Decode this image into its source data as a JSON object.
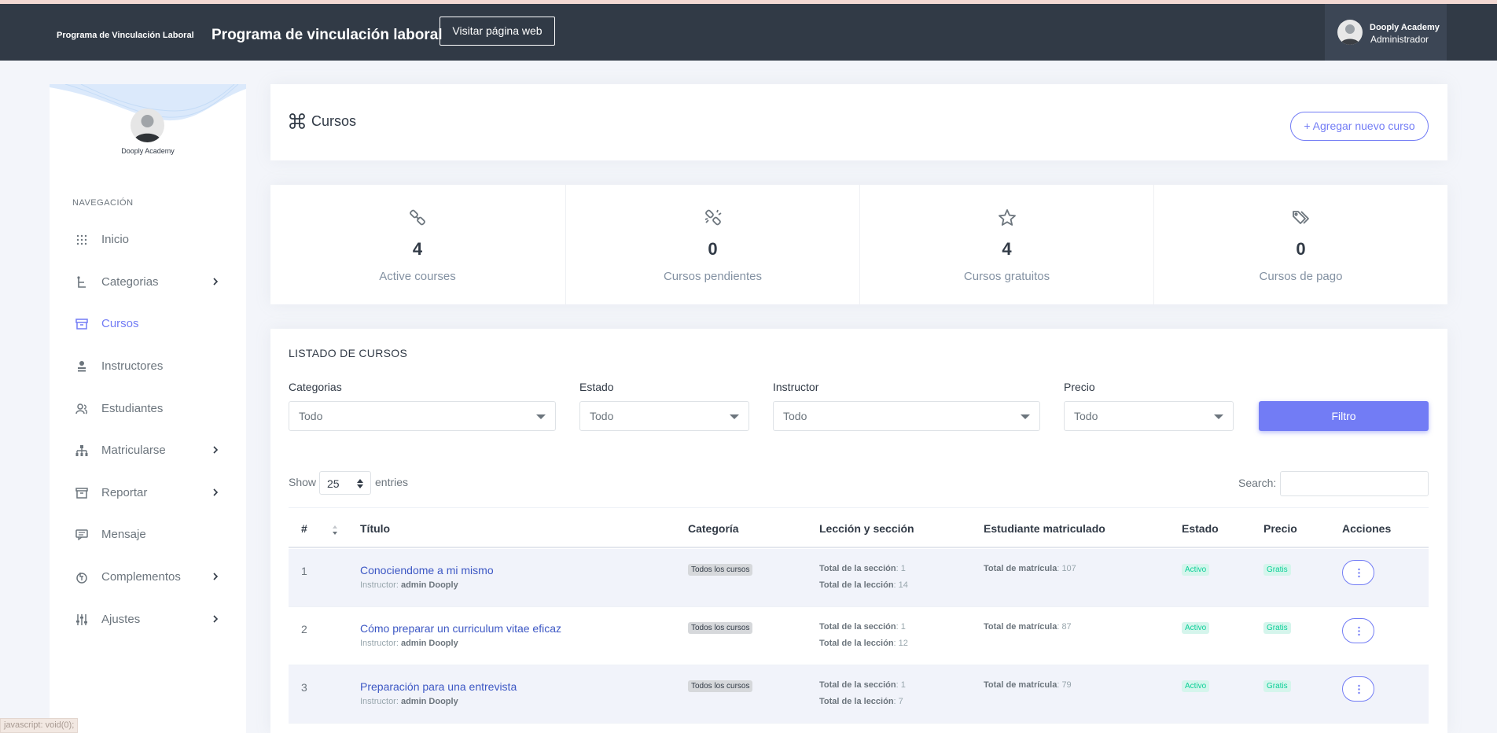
{
  "header": {
    "brand_small": "Programa de Vinculación Laboral",
    "brand_title": "Programa de vinculación laboral",
    "visit_button": "Visitar página web",
    "user_name": "Dooply Academy",
    "user_role": "Administrador"
  },
  "sidebar": {
    "profile_name": "Dooply Academy",
    "section_title": "NAVEGACIÓN",
    "items": [
      {
        "label": "Inicio",
        "icon": "dots-grid-icon",
        "has_submenu": false,
        "active": false
      },
      {
        "label": "Categorias",
        "icon": "category-tree-icon",
        "has_submenu": true,
        "active": false
      },
      {
        "label": "Cursos",
        "icon": "archive-icon",
        "has_submenu": false,
        "active": true
      },
      {
        "label": "Instructores",
        "icon": "instructor-icon",
        "has_submenu": false,
        "active": false
      },
      {
        "label": "Estudiantes",
        "icon": "students-icon",
        "has_submenu": false,
        "active": false
      },
      {
        "label": "Matricularse",
        "icon": "sitemap-icon",
        "has_submenu": true,
        "active": false
      },
      {
        "label": "Reportar",
        "icon": "report-icon",
        "has_submenu": true,
        "active": false
      },
      {
        "label": "Mensaje",
        "icon": "message-icon",
        "has_submenu": false,
        "active": false
      },
      {
        "label": "Complementos",
        "icon": "puzzle-icon",
        "has_submenu": true,
        "active": false
      },
      {
        "label": "Ajustes",
        "icon": "sliders-icon",
        "has_submenu": true,
        "active": false
      }
    ]
  },
  "page": {
    "title": "Cursos",
    "add_button": "+ Agregar nuevo curso"
  },
  "stats": [
    {
      "value": "4",
      "label": "Active courses",
      "icon": "link-icon"
    },
    {
      "value": "0",
      "label": "Cursos pendientes",
      "icon": "broken-link-icon"
    },
    {
      "value": "4",
      "label": "Cursos gratuitos",
      "icon": "star-icon"
    },
    {
      "value": "0",
      "label": "Cursos de pago",
      "icon": "tags-icon"
    }
  ],
  "list": {
    "title": "LISTADO DE CURSOS",
    "filters": {
      "categorias": {
        "label": "Categorias",
        "value": "Todo"
      },
      "estado": {
        "label": "Estado",
        "value": "Todo"
      },
      "instructor": {
        "label": "Instructor",
        "value": "Todo"
      },
      "precio": {
        "label": "Precio",
        "value": "Todo"
      }
    },
    "filter_button": "Filtro",
    "show_label": "Show",
    "entries_value": "25",
    "entries_label": "entries",
    "search_label": "Search:",
    "columns": [
      "#",
      "Título",
      "Categoría",
      "Lección y sección",
      "Estudiante matriculado",
      "Estado",
      "Precio",
      "Acciones"
    ],
    "rows": [
      {
        "num": "1",
        "title": "Conociendome a mi mismo",
        "instructor_label": "Instructor:",
        "instructor": "admin Dooply",
        "category": "Todos los cursos",
        "section_label": "Total de la sección",
        "section_value": ": 1",
        "lesson_label": "Total de la lección",
        "lesson_value": ": 14",
        "enroll_label": "Total de matrícula",
        "enroll_value": ": 107",
        "status": "Activo",
        "price": "Gratis"
      },
      {
        "num": "2",
        "title": "Cómo preparar un curriculum vitae eficaz",
        "instructor_label": "Instructor:",
        "instructor": "admin Dooply",
        "category": "Todos los cursos",
        "section_label": "Total de la sección",
        "section_value": ": 1",
        "lesson_label": "Total de la lección",
        "lesson_value": ": 12",
        "enroll_label": "Total de matrícula",
        "enroll_value": ": 87",
        "status": "Activo",
        "price": "Gratis"
      },
      {
        "num": "3",
        "title": "Preparación para una entrevista",
        "instructor_label": "Instructor:",
        "instructor": "admin Dooply",
        "category": "Todos los cursos",
        "section_label": "Total de la sección",
        "section_value": ": 1",
        "lesson_label": "Total de la lección",
        "lesson_value": ": 7",
        "enroll_label": "Total de matrícula",
        "enroll_value": ": 79",
        "status": "Activo",
        "price": "Gratis"
      }
    ]
  },
  "statusbar": "javascript: void(0);",
  "colors": {
    "header_bg": "#313a46",
    "accent": "#727cf5",
    "link": "#3c57c4",
    "success": "#0acf97",
    "page_bg": "#f3f5fa"
  }
}
